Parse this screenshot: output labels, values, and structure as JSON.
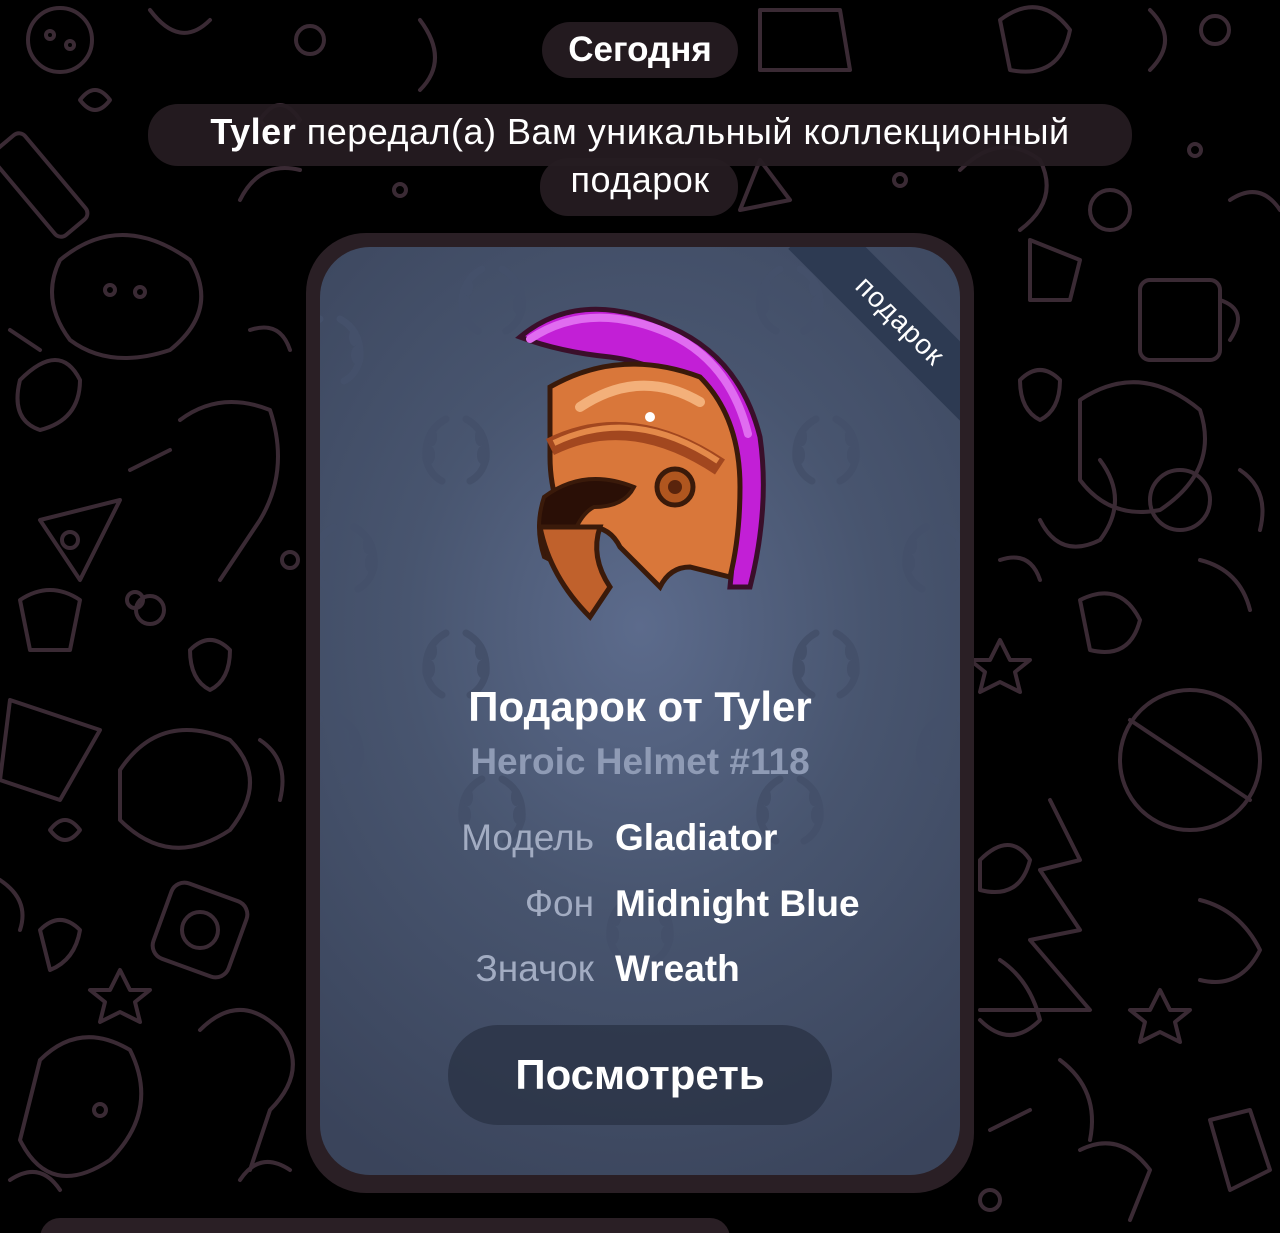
{
  "date_label": "Сегодня",
  "service_message": {
    "sender": "Tyler",
    "text": " передал(а) Вам уникальный коллекционный подарок"
  },
  "gift_card": {
    "ribbon_label": "подарок",
    "title": "Подарок от Tyler",
    "subtitle": "Heroic Helmet #118",
    "attributes": {
      "model": {
        "label": "Модель",
        "value": "Gladiator"
      },
      "backdrop": {
        "label": "Фон",
        "value": "Midnight Blue"
      },
      "symbol": {
        "label": "Значок",
        "value": "Wreath"
      }
    },
    "view_button_label": "Посмотреть",
    "gift_icon": "spartan-helmet-icon",
    "pattern_icon": "wreath-icon",
    "colors": {
      "backdrop_center": "#5c6b8c",
      "backdrop_edge": "#3a445b",
      "crest": "#c21fd6",
      "helmet": "#d9773a"
    }
  },
  "background_pattern_icon": "doodle-pattern"
}
